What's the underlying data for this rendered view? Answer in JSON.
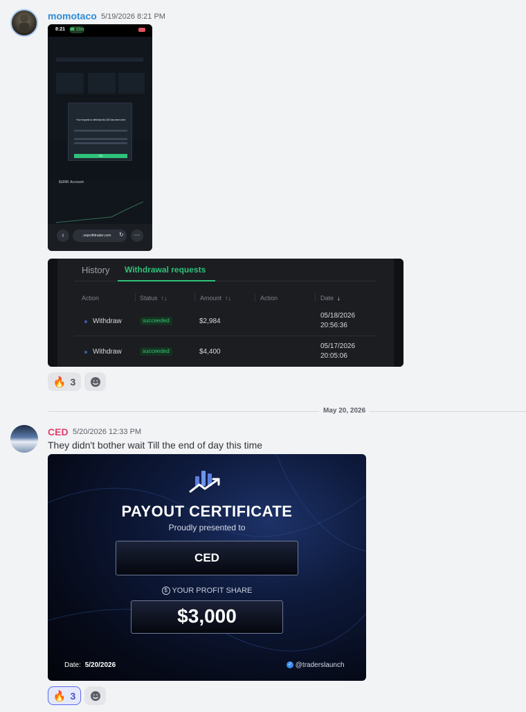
{
  "messages": [
    {
      "username": "momotaco",
      "username_color": "#2e8bd8",
      "timestamp": "5/19/2026 8:21 PM",
      "phone": {
        "time": "8:21",
        "call": "15m",
        "url": ".xeprofittrader.com",
        "dialog_title": "Your request to withdraw $4,400 has been sent",
        "dialog_ok": "OK",
        "account_label": "$100K Account"
      },
      "withdrawal": {
        "tabs": [
          "History",
          "Withdrawal requests"
        ],
        "active_tab": "Withdrawal requests",
        "columns": [
          "Action",
          "Status",
          "Amount",
          "Action",
          "Date"
        ],
        "rows": [
          {
            "action": "Withdraw",
            "status": "succeeded",
            "amount": "$2,984",
            "date": "05/18/2026",
            "time": "20:56:36"
          },
          {
            "action": "Withdraw",
            "status": "succeeded",
            "amount": "$4,400",
            "date": "05/17/2026",
            "time": "20:05:06"
          }
        ]
      },
      "reactions": [
        {
          "emoji": "🔥",
          "count": "3"
        }
      ],
      "add_reaction_icon": "smile-add-icon"
    },
    {
      "username": "CED",
      "username_color": "#e03e6c",
      "timestamp": "5/20/2026 12:33 PM",
      "text": "They didn't bother wait Till the end of day this time",
      "certificate": {
        "title": "PAYOUT CERTIFICATE",
        "subtitle": "Proudly presented to",
        "name": "CED",
        "share_label": "YOUR PROFIT SHARE",
        "amount": "$3,000",
        "date_label": "Date:",
        "date": "5/20/2026",
        "handle": "@traderslaunch"
      },
      "reactions": [
        {
          "emoji": "🔥",
          "count": "3",
          "active": true
        }
      ],
      "add_reaction_icon": "smile-add-icon"
    }
  ],
  "divider": {
    "label": "May 20, 2026"
  },
  "colors": {
    "accent_green": "#2fc27a",
    "background": "#f2f3f5"
  }
}
